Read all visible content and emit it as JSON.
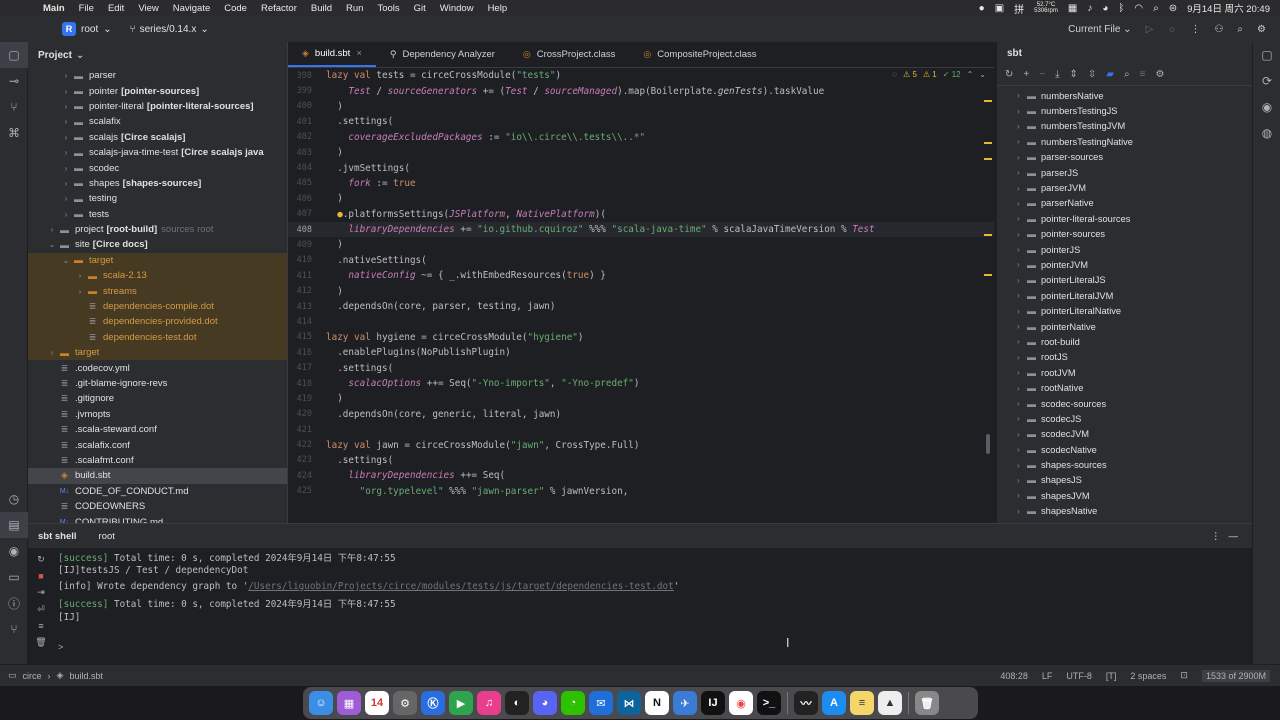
{
  "menubar": {
    "items": [
      "Main",
      "File",
      "Edit",
      "View",
      "Navigate",
      "Code",
      "Refactor",
      "Build",
      "Run",
      "Tools",
      "Git",
      "Window",
      "Help"
    ],
    "temp": "52.7°C",
    "fan": "5306rpm",
    "datetime": "9月14日 周六 20:49"
  },
  "titlebar": {
    "project_badge": "R",
    "project": "root",
    "branch": "series/0.14.x",
    "run_config": "Current File"
  },
  "project_panel": {
    "title": "Project",
    "rows": [
      {
        "indent": 3,
        "arrow": "›",
        "icon": "folder",
        "label": "parser",
        "bold": "",
        "extra": "",
        "state": ""
      },
      {
        "indent": 3,
        "arrow": "›",
        "icon": "folder",
        "label": "pointer",
        "bold": "[pointer-sources]",
        "extra": "",
        "state": ""
      },
      {
        "indent": 3,
        "arrow": "›",
        "icon": "folder",
        "label": "pointer-literal",
        "bold": "[pointer-literal-sources]",
        "extra": "",
        "state": ""
      },
      {
        "indent": 3,
        "arrow": "›",
        "icon": "folder",
        "label": "scalafix",
        "bold": "",
        "extra": "",
        "state": ""
      },
      {
        "indent": 3,
        "arrow": "›",
        "icon": "folder",
        "label": "scalajs",
        "bold": "[Circe scalajs]",
        "extra": "",
        "state": ""
      },
      {
        "indent": 3,
        "arrow": "›",
        "icon": "folder",
        "label": "scalajs-java-time-test",
        "bold": "[Circe scalajs java",
        "extra": "",
        "state": ""
      },
      {
        "indent": 3,
        "arrow": "›",
        "icon": "folder",
        "label": "scodec",
        "bold": "",
        "extra": "",
        "state": ""
      },
      {
        "indent": 3,
        "arrow": "›",
        "icon": "folder",
        "label": "shapes",
        "bold": "[shapes-sources]",
        "extra": "",
        "state": ""
      },
      {
        "indent": 3,
        "arrow": "›",
        "icon": "folder",
        "label": "testing",
        "bold": "",
        "extra": "",
        "state": ""
      },
      {
        "indent": 3,
        "arrow": "›",
        "icon": "folder",
        "label": "tests",
        "bold": "",
        "extra": "",
        "state": ""
      },
      {
        "indent": 2,
        "arrow": "›",
        "icon": "folder",
        "label": "project",
        "bold": "[root-build]",
        "extra": "sources root",
        "state": ""
      },
      {
        "indent": 2,
        "arrow": "⌄",
        "icon": "folder",
        "label": "site",
        "bold": "[Circe docs]",
        "extra": "",
        "state": ""
      },
      {
        "indent": 3,
        "arrow": "⌄",
        "icon": "orange",
        "label": "target",
        "bold": "",
        "extra": "",
        "state": "excluded"
      },
      {
        "indent": 4,
        "arrow": "›",
        "icon": "orange",
        "label": "scala-2.13",
        "bold": "",
        "extra": "",
        "state": "excluded"
      },
      {
        "indent": 4,
        "arrow": "›",
        "icon": "orange",
        "label": "streams",
        "bold": "",
        "extra": "",
        "state": "excluded"
      },
      {
        "indent": 4,
        "arrow": "",
        "icon": "file",
        "label": "dependencies-compile.dot",
        "bold": "",
        "extra": "",
        "state": "excluded"
      },
      {
        "indent": 4,
        "arrow": "",
        "icon": "file",
        "label": "dependencies-provided.dot",
        "bold": "",
        "extra": "",
        "state": "excluded"
      },
      {
        "indent": 4,
        "arrow": "",
        "icon": "file",
        "label": "dependencies-test.dot",
        "bold": "",
        "extra": "",
        "state": "excluded"
      },
      {
        "indent": 2,
        "arrow": "›",
        "icon": "orange",
        "label": "target",
        "bold": "",
        "extra": "",
        "state": "excluded"
      },
      {
        "indent": 2,
        "arrow": "",
        "icon": "file",
        "label": ".codecov.yml",
        "bold": "",
        "extra": "",
        "state": ""
      },
      {
        "indent": 2,
        "arrow": "",
        "icon": "file",
        "label": ".git-blame-ignore-revs",
        "bold": "",
        "extra": "",
        "state": ""
      },
      {
        "indent": 2,
        "arrow": "",
        "icon": "file",
        "label": ".gitignore",
        "bold": "",
        "extra": "",
        "state": ""
      },
      {
        "indent": 2,
        "arrow": "",
        "icon": "file",
        "label": ".jvmopts",
        "bold": "",
        "extra": "",
        "state": ""
      },
      {
        "indent": 2,
        "arrow": "",
        "icon": "file",
        "label": ".scala-steward.conf",
        "bold": "",
        "extra": "",
        "state": ""
      },
      {
        "indent": 2,
        "arrow": "",
        "icon": "file",
        "label": ".scalafix.conf",
        "bold": "",
        "extra": "",
        "state": ""
      },
      {
        "indent": 2,
        "arrow": "",
        "icon": "file",
        "label": ".scalafmt.conf",
        "bold": "",
        "extra": "",
        "state": ""
      },
      {
        "indent": 2,
        "arrow": "",
        "icon": "sbt",
        "label": "build.sbt",
        "bold": "",
        "extra": "",
        "state": "selected"
      },
      {
        "indent": 2,
        "arrow": "",
        "icon": "md",
        "label": "CODE_OF_CONDUCT.md",
        "bold": "",
        "extra": "",
        "state": ""
      },
      {
        "indent": 2,
        "arrow": "",
        "icon": "file",
        "label": "CODEOWNERS",
        "bold": "",
        "extra": "",
        "state": ""
      },
      {
        "indent": 2,
        "arrow": "",
        "icon": "md",
        "label": "CONTRIBUTING.md",
        "bold": "",
        "extra": "",
        "state": ""
      }
    ]
  },
  "editor": {
    "tabs": [
      {
        "label": "build.sbt",
        "active": true
      },
      {
        "label": "Dependency Analyzer",
        "active": false
      },
      {
        "label": "CrossProject.class",
        "active": false
      },
      {
        "label": "CompositeProject.class",
        "active": false
      }
    ],
    "inspections": {
      "warnings": "5",
      "weak": "1",
      "typos": "12"
    },
    "current_line": "408"
  },
  "sbt_panel": {
    "title": "sbt",
    "items": [
      "numbersNative",
      "numbersTestingJS",
      "numbersTestingJVM",
      "numbersTestingNative",
      "parser-sources",
      "parserJS",
      "parserJVM",
      "parserNative",
      "pointer-literal-sources",
      "pointer-sources",
      "pointerJS",
      "pointerJVM",
      "pointerLiteralJS",
      "pointerLiteralJVM",
      "pointerLiteralNative",
      "pointerNative",
      "root-build",
      "rootJS",
      "rootJVM",
      "rootNative",
      "scodec-sources",
      "scodecJS",
      "scodecJVM",
      "scodecNative",
      "shapes-sources",
      "shapesJS",
      "shapesJVM",
      "shapesNative"
    ]
  },
  "shell": {
    "tab_title": "sbt shell",
    "tab_root": "root",
    "lines": [
      {
        "prefix": "[success]",
        "text": " Total time: 0 s, completed 2024年9月14日 下午8:47:55",
        "link": ""
      },
      {
        "prefix": "",
        "text": "[IJ]testsJS / Test / dependencyDot",
        "link": ""
      },
      {
        "prefix": "",
        "text": "[info] Wrote dependency graph to '",
        "link": "/Users/liguobin/Projects/circe/modules/tests/js/target/dependencies-test.dot",
        "suffix": "'"
      },
      {
        "prefix": "[success]",
        "text": " Total time: 0 s, completed 2024年9月14日 下午8:47:55",
        "link": ""
      },
      {
        "prefix": "",
        "text": "[IJ]",
        "link": ""
      }
    ],
    "prompt": ">"
  },
  "statusbar": {
    "crumb_project": "circe",
    "crumb_file": "build.sbt",
    "position": "408:28",
    "line_sep": "LF",
    "encoding": "UTF-8",
    "indent": "2 spaces",
    "memory": "1533 of 2900M"
  },
  "dock": {
    "calendar_day": "14"
  }
}
